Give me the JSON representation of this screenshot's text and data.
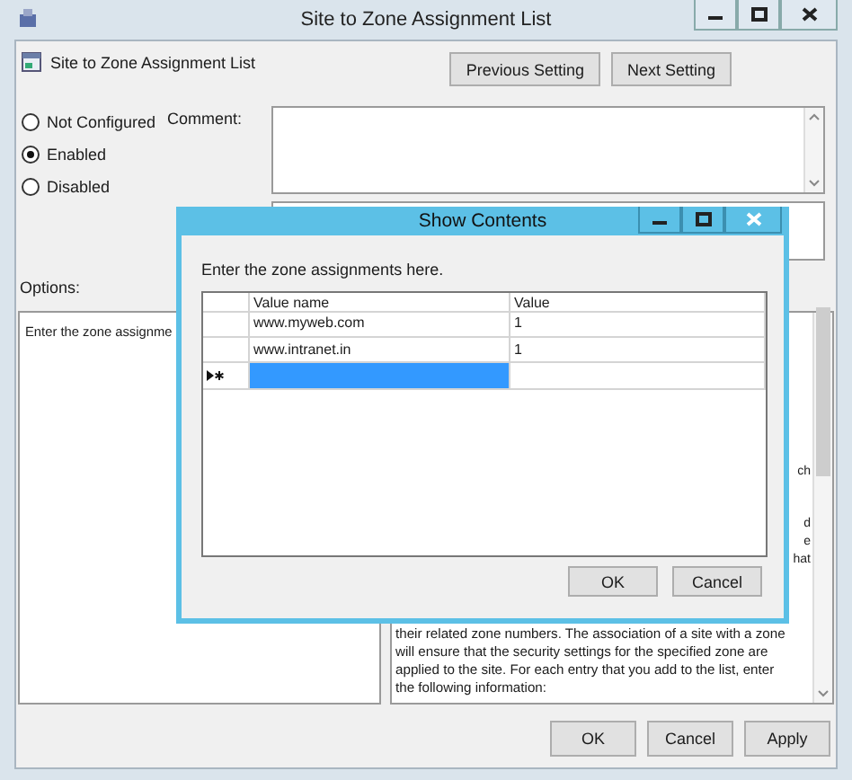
{
  "window": {
    "title": "Site to Zone Assignment List"
  },
  "header": {
    "title": "Site to Zone Assignment List",
    "buttons": [
      "Previous Setting",
      "Next Setting"
    ]
  },
  "state_options": [
    {
      "label": "Not Configured",
      "selected": false
    },
    {
      "label": "Enabled",
      "selected": true
    },
    {
      "label": "Disabled",
      "selected": false
    }
  ],
  "comment": {
    "label": "Comment:"
  },
  "options": {
    "label": "Options:",
    "text": "Enter the zone assignme"
  },
  "help": {
    "fragments": [
      "ch",
      "d",
      "e",
      "hat"
    ],
    "lines": [
      "their related zone numbers. The association of a site with a zone",
      "will ensure that the security settings for the specified zone are",
      "applied to the site.  For each entry that you add to the list, enter",
      "the following information:"
    ]
  },
  "buttons": [
    "OK",
    "Cancel",
    "Apply"
  ],
  "dialog": {
    "title": "Show Contents",
    "instruction": "Enter the zone assignments here.",
    "columns": [
      "Value name",
      "Value"
    ],
    "rows": [
      {
        "value_name": "www.myweb.com",
        "value": "1"
      },
      {
        "value_name": "www.intranet.in",
        "value": "1"
      }
    ],
    "new_row": {
      "selected": true
    },
    "buttons": [
      "OK",
      "Cancel"
    ]
  }
}
